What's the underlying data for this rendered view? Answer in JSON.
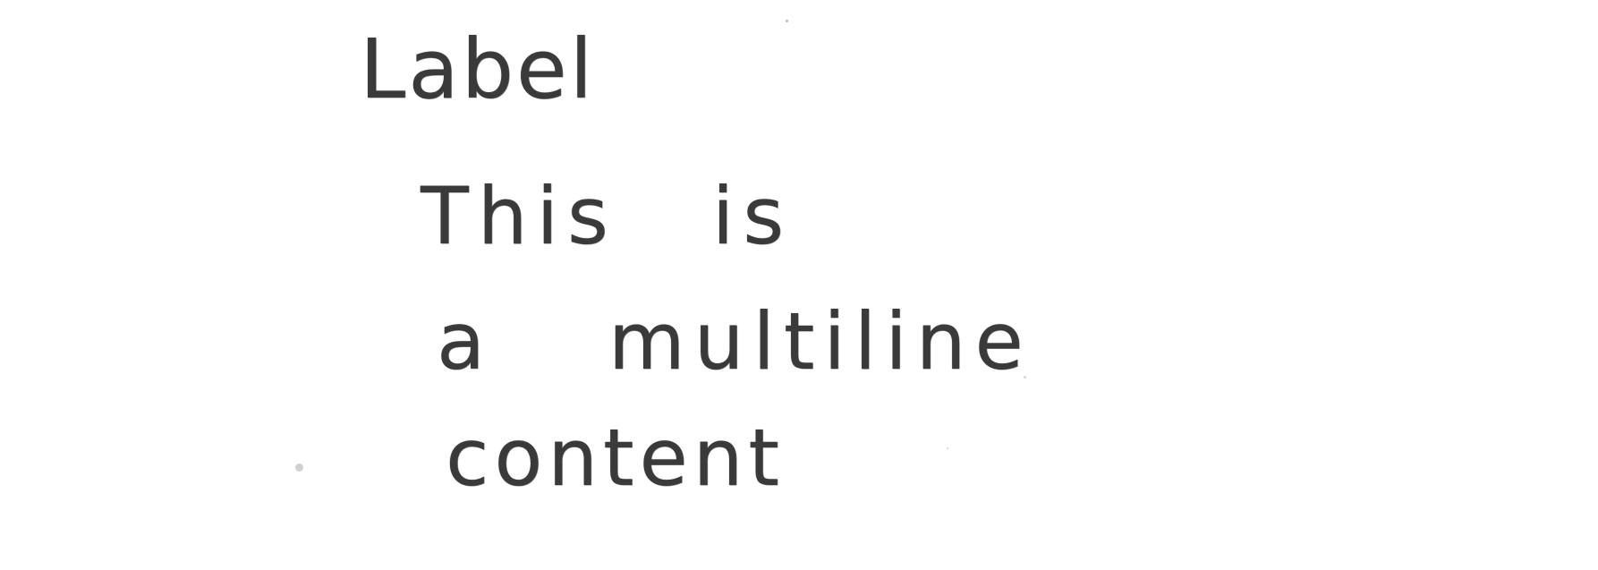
{
  "note": {
    "label": "Label",
    "content_lines": [
      "This is",
      "a multiline",
      "content"
    ]
  }
}
